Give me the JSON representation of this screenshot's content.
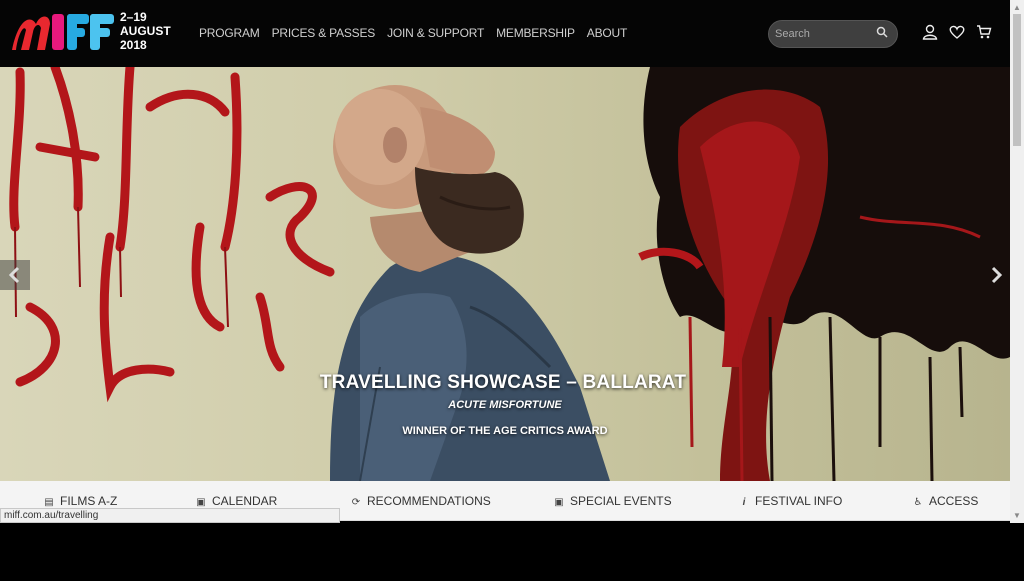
{
  "header": {
    "festival_dates_line1": "2–19",
    "festival_dates_line2": "AUGUST",
    "festival_dates_line3": "2018",
    "nav": [
      {
        "label": "PROGRAM"
      },
      {
        "label": "PRICES & PASSES"
      },
      {
        "label": "JOIN & SUPPORT"
      },
      {
        "label": "MEMBERSHIP"
      },
      {
        "label": "ABOUT"
      }
    ],
    "search_placeholder": "Search",
    "icons": [
      "user-icon",
      "heart-icon",
      "cart-icon"
    ]
  },
  "hero": {
    "title": "TRAVELLING SHOWCASE – BALLARAT",
    "film": "ACUTE MISFORTUNE",
    "note": "WINNER OF THE AGE CRITICS AWARD"
  },
  "quick_links": [
    {
      "label": "FILMS A-Z",
      "icon": "film-icon"
    },
    {
      "label": "CALENDAR",
      "icon": "calendar-icon"
    },
    {
      "label": "RECOMMENDATIONS",
      "icon": "pin-icon"
    },
    {
      "label": "SPECIAL EVENTS",
      "icon": "star-icon"
    },
    {
      "label": "FESTIVAL INFO",
      "icon": "info-icon"
    },
    {
      "label": "ACCESS",
      "icon": "access-icon"
    }
  ],
  "status_url": "miff.com.au/travelling",
  "colors": {
    "logo_red": "#e8282f",
    "logo_pink": "#e8197d",
    "logo_blue": "#27aae1",
    "paint_red": "#b3161a"
  }
}
